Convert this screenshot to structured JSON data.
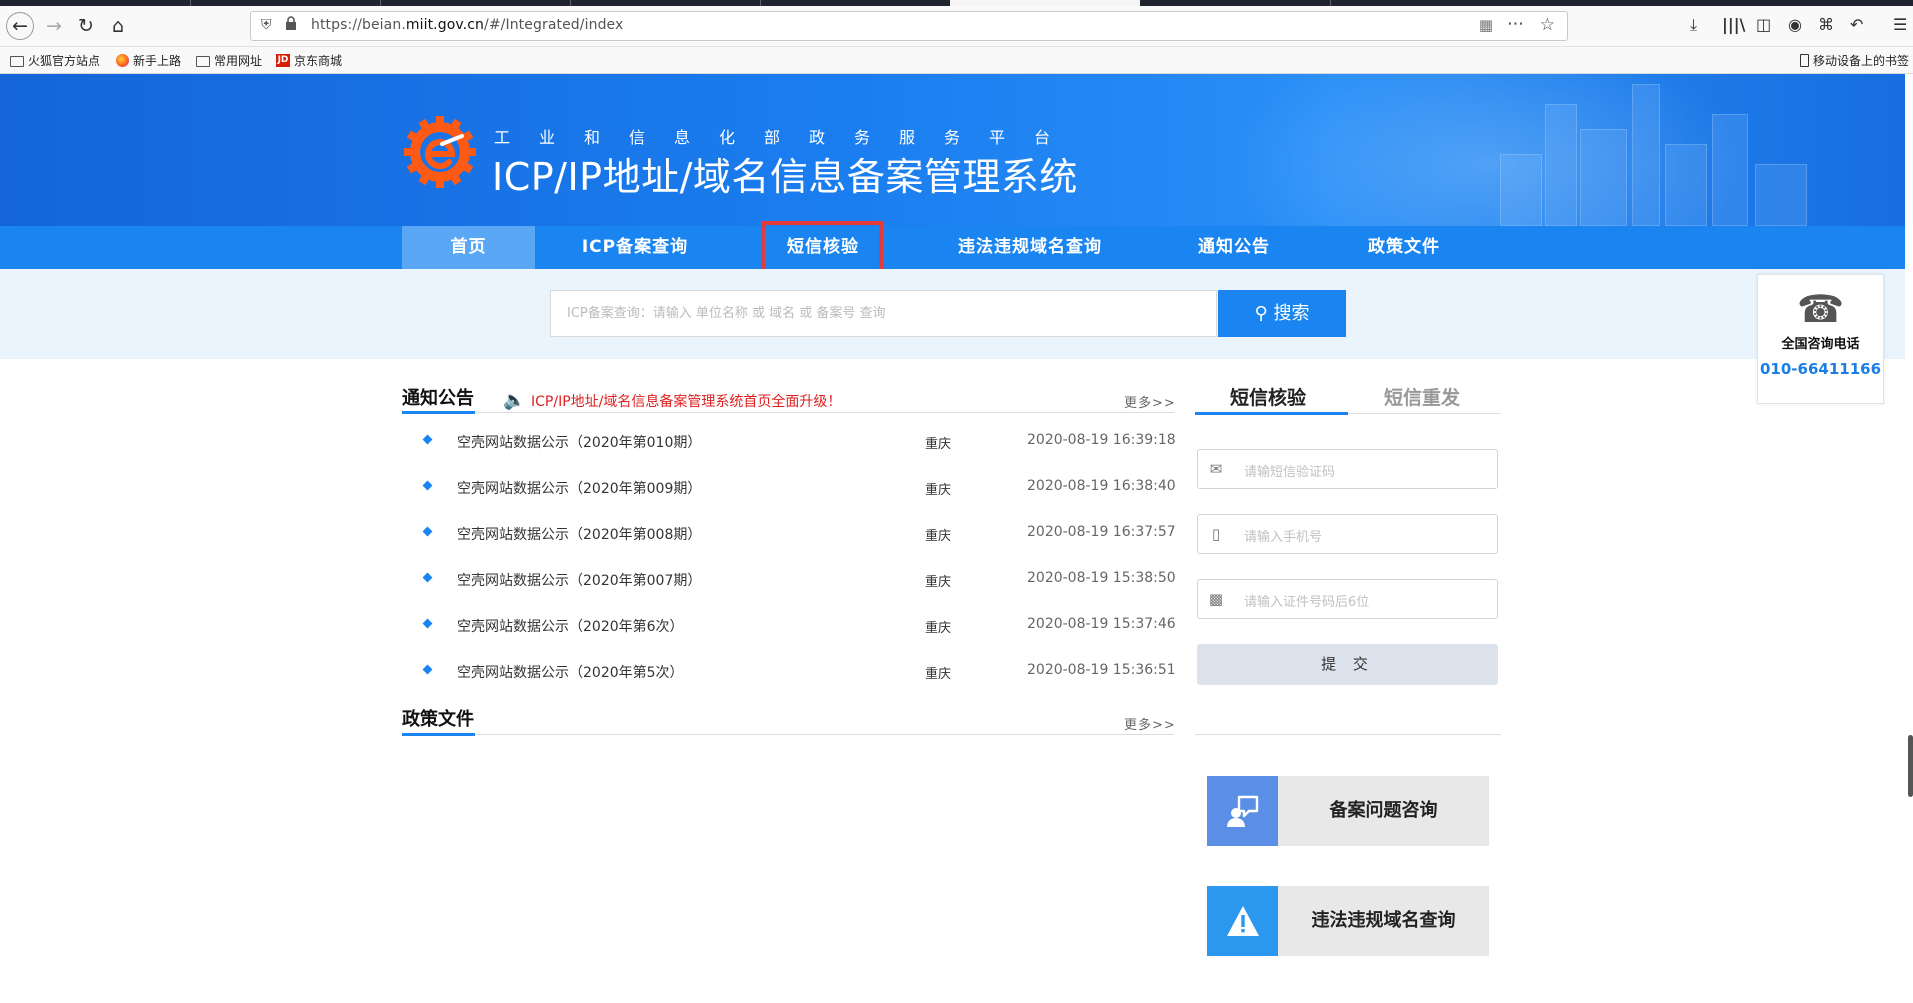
{
  "browser": {
    "url_prefix": "https://beian.",
    "url_domain": "miit.gov.cn",
    "url_suffix": "/#/Integrated/index",
    "bookmarks": [
      "火狐官方站点",
      "新手上路",
      "常用网址",
      "京东商城"
    ],
    "mobile_bookmarks": "移动设备上的书签",
    "jd_badge": "JD"
  },
  "header": {
    "subtitle": "工业和信息化部政务服务平台",
    "title": "ICP/IP地址/域名信息备案管理系统"
  },
  "nav": {
    "items": [
      "首页",
      "ICP备案查询",
      "短信核验",
      "违法违规域名查询",
      "通知公告",
      "政策文件"
    ],
    "active": "首页"
  },
  "search": {
    "placeholder": "ICP备案查询：请输入 单位名称 或 域名 或 备案号 查询",
    "button_label": "搜索"
  },
  "hotline": {
    "label": "全国咨询电话",
    "number": "010-66411166"
  },
  "notices": {
    "title": "通知公告",
    "marquee": "ICP/IP地址/域名信息备案管理系统首页全面升级！",
    "more": "更多>>",
    "rows": [
      {
        "title": "空壳网站数据公示（2020年第010期）",
        "region": "重庆",
        "time": "2020-08-19 16:39:18"
      },
      {
        "title": "空壳网站数据公示（2020年第009期）",
        "region": "重庆",
        "time": "2020-08-19 16:38:40"
      },
      {
        "title": "空壳网站数据公示（2020年第008期）",
        "region": "重庆",
        "time": "2020-08-19 16:37:57"
      },
      {
        "title": "空壳网站数据公示（2020年第007期）",
        "region": "重庆",
        "time": "2020-08-19 15:38:50"
      },
      {
        "title": "空壳网站数据公示（2020年第6次）",
        "region": "重庆",
        "time": "2020-08-19 15:37:46"
      },
      {
        "title": "空壳网站数据公示（2020年第5次）",
        "region": "重庆",
        "time": "2020-08-19 15:36:51"
      }
    ]
  },
  "policy": {
    "title": "政策文件",
    "more": "更多>>"
  },
  "sms": {
    "tab_verify": "短信核验",
    "tab_resend": "短信重发",
    "code_placeholder": "请输短信验证码",
    "phone_placeholder": "请输入手机号",
    "id_placeholder": "请输入证件号码后6位",
    "submit": "提 交"
  },
  "quick_links": {
    "consult": "备案问题咨询",
    "illegal": "违法违规域名查询"
  },
  "colors": {
    "primary": "#1a85f0",
    "highlight": "#e33a3a",
    "alert": "#e02020"
  }
}
